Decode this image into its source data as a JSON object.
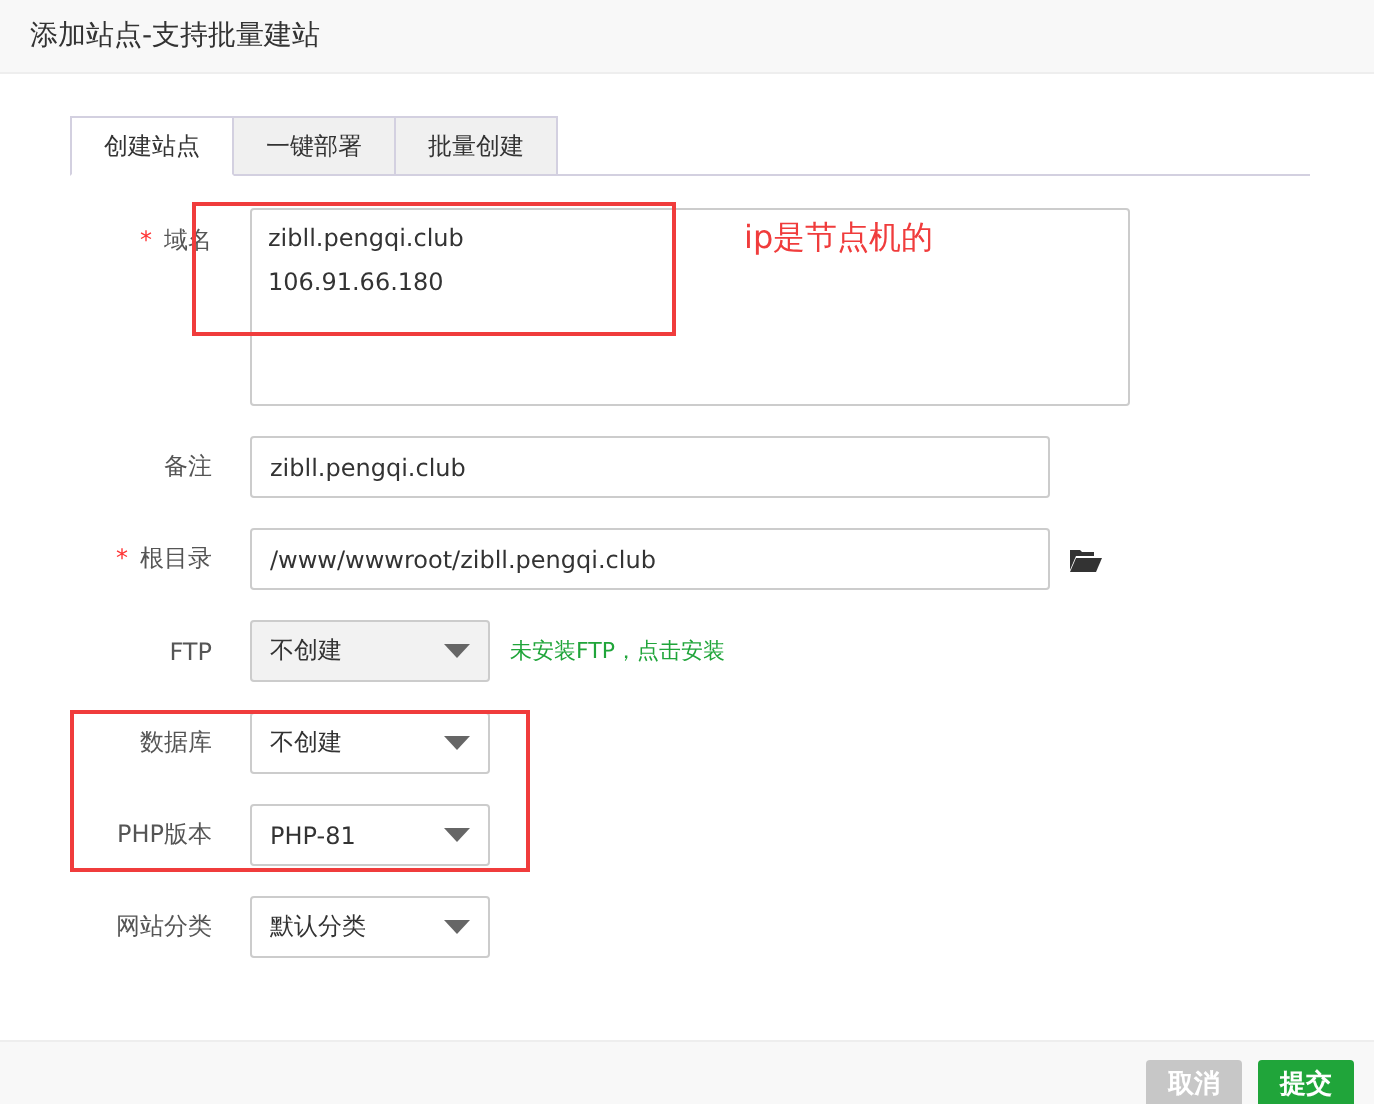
{
  "window": {
    "title": "添加站点-支持批量建站"
  },
  "tabs": [
    {
      "label": "创建站点",
      "selected": true
    },
    {
      "label": "一键部署",
      "selected": false
    },
    {
      "label": "批量创建",
      "selected": false
    }
  ],
  "form": [
    {
      "kind": "textarea",
      "label": "域名",
      "mark": "*",
      "lines": [
        "zibll.pengqi.club",
        "106.91.66.180"
      ]
    },
    {
      "kind": "input",
      "label": "备注",
      "value": "zibll.pengqi.club"
    },
    {
      "kind": "path",
      "label": "根目录",
      "mark": "*",
      "value": "/www/wwwroot/zibll.pengqi.club"
    },
    {
      "kind": "select",
      "label": "FTP",
      "value": "不创建",
      "disabled": true,
      "hint": "未安装FTP，点击安装"
    },
    {
      "kind": "select",
      "label": "数据库",
      "value": "不创建",
      "disabled": false
    },
    {
      "kind": "select",
      "label": "PHP版本",
      "value": "PHP-81",
      "disabled": false
    },
    {
      "kind": "select",
      "label": "网站分类",
      "value": "默认分类",
      "disabled": false
    }
  ],
  "annotation": {
    "note": "ip是节点机的"
  },
  "buttons": [
    {
      "label": "取消",
      "kind": "cancel"
    },
    {
      "label": "提交",
      "kind": "submit"
    }
  ]
}
